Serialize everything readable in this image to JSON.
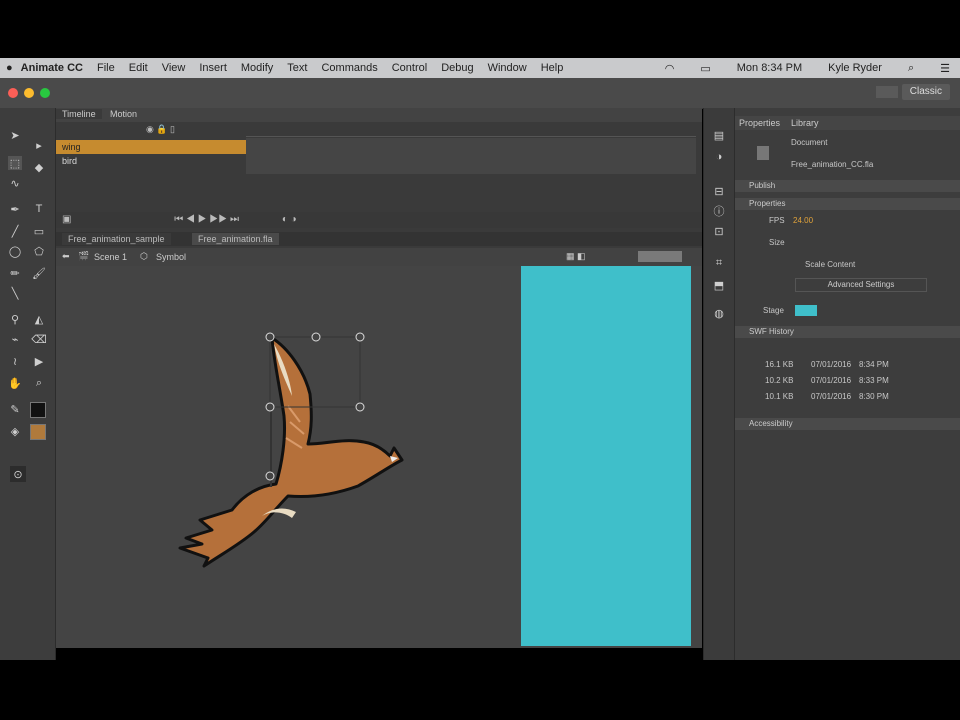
{
  "menubar": {
    "app_name": "Animate CC",
    "items": [
      "File",
      "Edit",
      "View",
      "Insert",
      "Modify",
      "Text",
      "Commands",
      "Control",
      "Debug",
      "Window",
      "Help"
    ],
    "clock": "Mon 8:34 PM",
    "user": "Kyle Ryder"
  },
  "window": {
    "workspace_label": "Classic"
  },
  "timeline": {
    "tab_timeline": "Timeline",
    "tab_motion": "Motion",
    "layers": [
      {
        "name": "wing",
        "selected": true
      },
      {
        "name": "bird",
        "selected": false
      }
    ]
  },
  "document": {
    "tabs": [
      "Free_animation_sample",
      "Free_animation.fla"
    ],
    "scene_label": "Scene 1",
    "symbol_label": "Symbol"
  },
  "stage": {
    "stage_color": "#3fbfca",
    "pasteboard_color": "#444444"
  },
  "properties": {
    "tab_properties": "Properties",
    "tab_library": "Library",
    "doc_label": "Document",
    "doc_name": "Free_animation_CC.fla",
    "section_publish": "Publish",
    "section_properties": "Properties",
    "fps_label": "FPS",
    "fps_value": "24.00",
    "size_label": "Size",
    "scale_content": "Scale Content",
    "advanced_settings": "Advanced Settings",
    "stage_label": "Stage",
    "section_swf_history": "SWF History",
    "history_values": [
      "16.1 KB",
      "10.2 KB",
      "10.1 KB"
    ],
    "history_dates": [
      "07/01/2016",
      "07/01/2016",
      "07/01/2016"
    ],
    "history_times": [
      "8:34 PM",
      "8:33 PM",
      "8:30 PM"
    ],
    "section_accessibility": "Accessibility"
  }
}
